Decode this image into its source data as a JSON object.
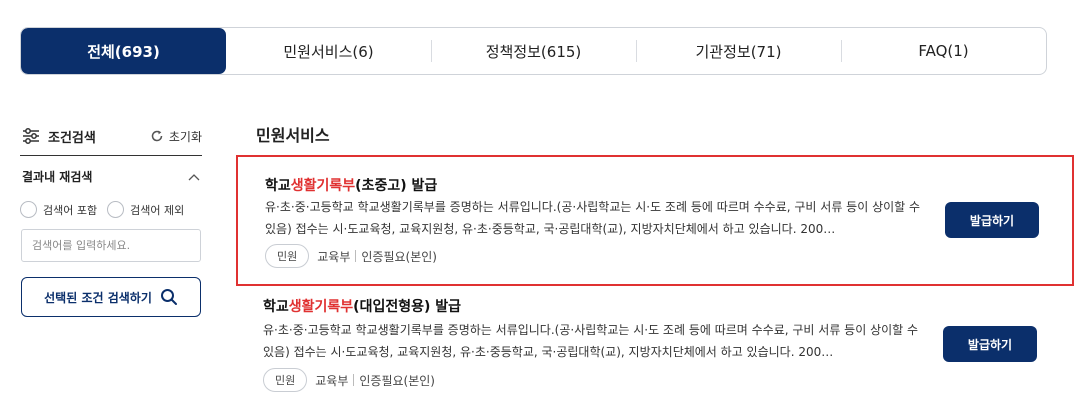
{
  "tabs": [
    {
      "label": "전체(693)",
      "active": true
    },
    {
      "label": "민원서비스(6)",
      "active": false
    },
    {
      "label": "정책정보(615)",
      "active": false
    },
    {
      "label": "기관정보(71)",
      "active": false
    },
    {
      "label": "FAQ(1)",
      "active": false
    }
  ],
  "sidebar": {
    "filter_title": "조건검색",
    "reset_label": "초기화",
    "re_search_title": "결과내 재검색",
    "radio_include": "검색어 포함",
    "radio_exclude": "검색어 제외",
    "keyword_placeholder": "검색어를 입력하세요.",
    "search_button": "선택된 조건 검색하기"
  },
  "main": {
    "section_title": "민원서비스",
    "results": [
      {
        "title_prefix": "학교",
        "title_highlight": "생활기록부",
        "title_suffix": "(초중고) 발급",
        "description": "유·초·중·고등학교 학교생활기록부를 증명하는 서류입니다.(공·사립학교는 시·도 조례 등에 따르며 수수료, 구비 서류 등이 상이할 수 있음) 접수는 시·도교육청, 교육지원청, 유·초·중등학교, 국·공립대학(교), 지방자치단체에서 하고 있습니다. 200…",
        "tag": "민원",
        "agency": "교육부",
        "auth": "인증필요(본인)",
        "button": "발급하기"
      },
      {
        "title_prefix": "학교",
        "title_highlight": "생활기록부",
        "title_suffix": "(대입전형용) 발급",
        "description": "유·초·중·고등학교 학교생활기록부를 증명하는 서류입니다.(공·사립학교는 시·도 조례 등에 따르며 수수료, 구비 서류 등이 상이할 수 있음) 접수는 시·도교육청, 교육지원청, 유·초·중등학교, 국·공립대학(교), 지방자치단체에서 하고 있습니다. 200…",
        "tag": "민원",
        "agency": "교육부",
        "auth": "인증필요(본인)",
        "button": "발급하기"
      }
    ]
  },
  "colors": {
    "primary": "#0b2f6b",
    "highlight": "#e03131"
  }
}
